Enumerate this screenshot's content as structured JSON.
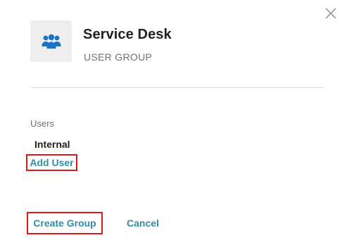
{
  "header": {
    "title": "Service Desk",
    "subtitle": "USER GROUP",
    "icon": "users-group-icon",
    "icon_color": "#1a73c9"
  },
  "users": {
    "label": "Users",
    "items": [
      "Internal"
    ],
    "add_label": "Add User"
  },
  "footer": {
    "create_label": "Create Group",
    "cancel_label": "Cancel"
  },
  "colors": {
    "link": "#2e8fa3",
    "highlight": "#e21414"
  }
}
